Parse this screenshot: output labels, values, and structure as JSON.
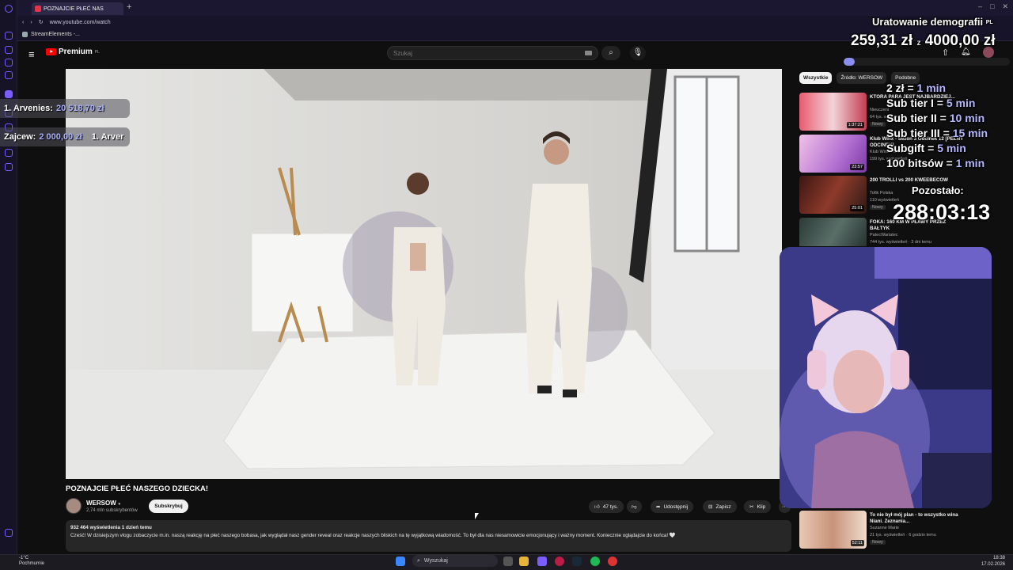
{
  "browser": {
    "tab_title": "POZNAJCIE PŁEĆ NAS",
    "new_tab": "+",
    "url": "www.youtube.com/watch",
    "bookmark": "StreamElements -..."
  },
  "youtube": {
    "logo": "Premium",
    "logo_region": "PL",
    "search_placeholder": "Szukaj",
    "video_title": "POZNAJCIE PŁEĆ NASZEGO DZIECKA!",
    "channel": "WERSOW",
    "subscribers": "2,74 mln subskrybentów",
    "subscribe_label": "Subskrybuj",
    "likes": "47 tys.",
    "share_label": "Udostępnij",
    "save_label": "Zapisz",
    "clip_label": "Klip",
    "stats": "932 464 wyświetlenia  1 dzień temu",
    "description": "Cześć! W dzisiejszym vlogu zobaczycie m.in. naszą reakcję na płeć naszego bobasa, jak wyglądał nasz gender reveal oraz reakcje naszych bliskich na tę wyjątkową wiadomość. To był dla nas niesamowicie emocjonujący i ważny moment. Koniecznie oglądajcie do końca! 🤍",
    "chips": [
      "Wszystkie",
      "Źródło: WERSOW",
      "Podobne"
    ],
    "recommendations": [
      {
        "title": "KTÓRA PARA JEST NAJBARDZIEJ...",
        "channel": "Nieuczeni",
        "meta": "64 tys. wyświetleń",
        "badge": "Nowy",
        "duration": "1:37:21",
        "color": "#c44a5a"
      },
      {
        "title": "Klub Winx - Sezon 3 Odcinek 12 [PEŁNY ODCINEK]",
        "channel": "Klub Winx Polska",
        "meta": "199 tys. wyświetleń",
        "badge": "",
        "duration": "23:57",
        "color": "#c278d8"
      },
      {
        "title": "200 TROLLI vs 200 KWEEBECÓW",
        "channel": "Tofik Polska",
        "meta": "110 wyświetleń",
        "badge": "Nowy",
        "duration": "25:01",
        "color": "#5a2a24"
      },
      {
        "title": "FOKA: 160 KM W PŁAWY PRZEZ BAŁTYK",
        "channel": "PatecWariatec",
        "meta": "744 tys. wyświetleń · 3 dni temu",
        "badge": "",
        "duration": "",
        "color": "#3c4a44"
      },
      {
        "title": "To nie był mój plan - to wszystko wina Niani. Zeznania...",
        "channel": "Suzanne Marie",
        "meta": "21 tys. wyświetleń · 6 godzin temu",
        "badge": "Nowy",
        "duration": "52:11",
        "color": "#d8b4a0"
      }
    ]
  },
  "overlay": {
    "goal_title": "Uratowanie demografii",
    "goal_flag": "PL",
    "goal_current": "259,31 zł",
    "goal_sep": "z",
    "goal_target": "4000,00 zł",
    "goal_progress": 0.065,
    "rules": [
      {
        "k": "2 zł",
        "v": "1 min"
      },
      {
        "k": "Sub tier I",
        "v": "5 min"
      },
      {
        "k": "Sub tier II",
        "v": "10 min"
      },
      {
        "k": "Sub tier III",
        "v": "15 min"
      },
      {
        "k": "Subgift",
        "v": "5 min"
      },
      {
        "k": "100 bitsów",
        "v": "1 min"
      }
    ],
    "remaining_label": "Pozostało:",
    "timer": "288:03:13",
    "donor1_name": "1. Arvenies:",
    "donor1_amount": "20 518,70 zł",
    "donor2_name": "Zajcew:",
    "donor2_amount": "2 000,00 zł",
    "donor2_extra": "1. Arver"
  },
  "taskbar": {
    "temp": "-1°C",
    "weather": "Pochmurnie",
    "search": "Wyszukaj",
    "time": "18:38",
    "date": "17.02.2026"
  },
  "colors": {
    "accent": "#8a8ef0",
    "brand": "#ff0000",
    "browser": "#7b5cff"
  }
}
